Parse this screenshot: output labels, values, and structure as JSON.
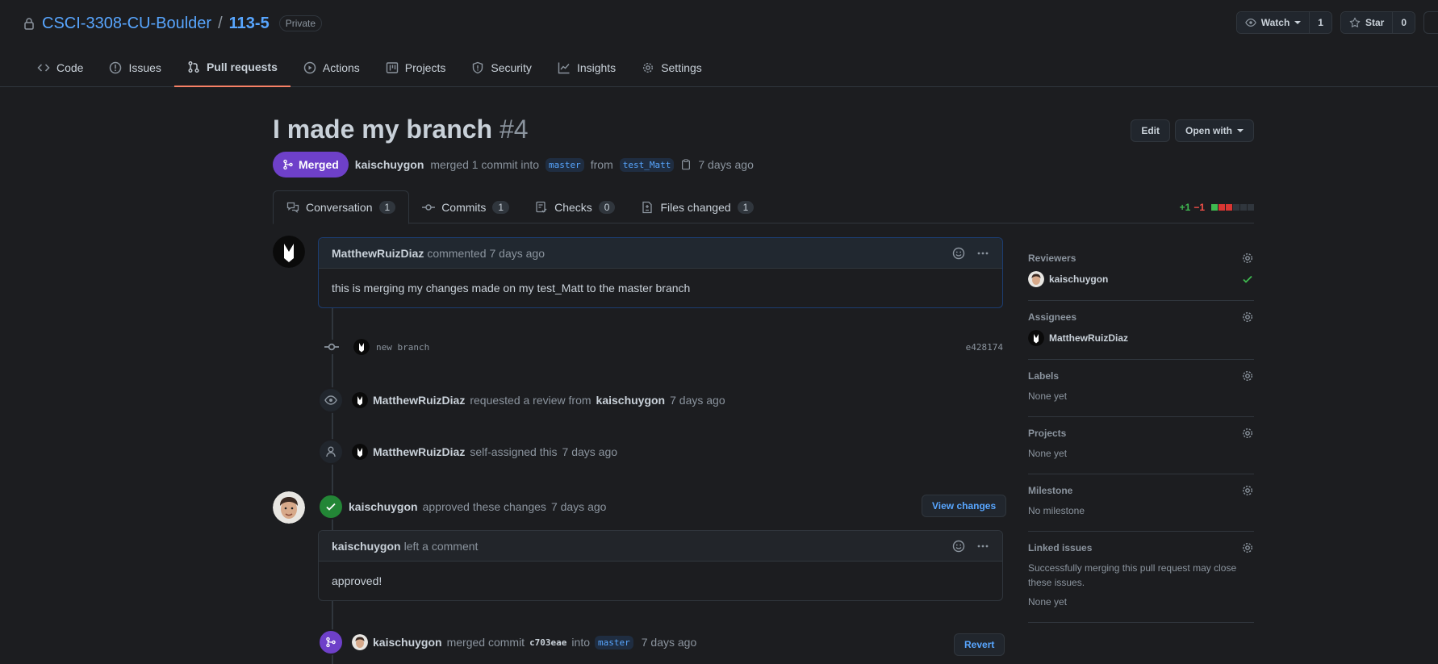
{
  "repo": {
    "owner": "CSCI-3308-CU-Boulder",
    "separator": "/",
    "name": "113-5",
    "visibility": "Private",
    "watch_label": "Watch",
    "watch_count": "1",
    "star_label": "Star",
    "star_count": "0"
  },
  "nav": {
    "code": "Code",
    "issues": "Issues",
    "pull_requests": "Pull requests",
    "actions": "Actions",
    "projects": "Projects",
    "security": "Security",
    "insights": "Insights",
    "settings": "Settings"
  },
  "pr": {
    "title": "I made my branch",
    "number": "#4",
    "edit_label": "Edit",
    "open_with_label": "Open with",
    "state": "Merged",
    "merger": "kaischuygon",
    "merge_text": "merged 1 commit into",
    "base_branch": "master",
    "from_text": "from",
    "head_branch": "test_Matt",
    "time": "7 days ago"
  },
  "tabs": {
    "conversation": {
      "label": "Conversation",
      "count": "1"
    },
    "commits": {
      "label": "Commits",
      "count": "1"
    },
    "checks": {
      "label": "Checks",
      "count": "0"
    },
    "files": {
      "label": "Files changed",
      "count": "1"
    }
  },
  "diffstat": {
    "additions": "+1",
    "deletions": "−1"
  },
  "timeline": {
    "comment1": {
      "author": "MatthewRuizDiaz",
      "action": "commented",
      "time": "7 days ago",
      "body": "this is merging my changes made on my test_Matt to the master branch"
    },
    "commit": {
      "message": "new branch",
      "sha": "e428174"
    },
    "review_request": {
      "actor": "MatthewRuizDiaz",
      "text": "requested a review from",
      "target": "kaischuygon",
      "time": "7 days ago"
    },
    "self_assign": {
      "actor": "MatthewRuizDiaz",
      "text": "self-assigned this",
      "time": "7 days ago"
    },
    "approval": {
      "actor": "kaischuygon",
      "text": "approved these changes",
      "time": "7 days ago",
      "view_changes_label": "View changes"
    },
    "comment2": {
      "author": "kaischuygon",
      "action": "left a comment",
      "body": "approved!"
    },
    "merge": {
      "actor": "kaischuygon",
      "text": "merged commit",
      "sha": "c703eae",
      "into_text": "into",
      "branch": "master",
      "time": "7 days ago",
      "revert_label": "Revert"
    }
  },
  "sidebar": {
    "reviewers": {
      "heading": "Reviewers",
      "value": "kaischuygon"
    },
    "assignees": {
      "heading": "Assignees",
      "value": "MatthewRuizDiaz"
    },
    "labels": {
      "heading": "Labels",
      "value": "None yet"
    },
    "projects": {
      "heading": "Projects",
      "value": "None yet"
    },
    "milestone": {
      "heading": "Milestone",
      "value": "No milestone"
    },
    "linked_issues": {
      "heading": "Linked issues",
      "description": "Successfully merging this pull request may close these issues.",
      "value": "None yet"
    }
  },
  "colors": {
    "background": "#1c1d20",
    "link": "#58a6ff",
    "merged": "#6e40c9",
    "approved": "#238636",
    "active_tab_underline": "#f78166"
  }
}
